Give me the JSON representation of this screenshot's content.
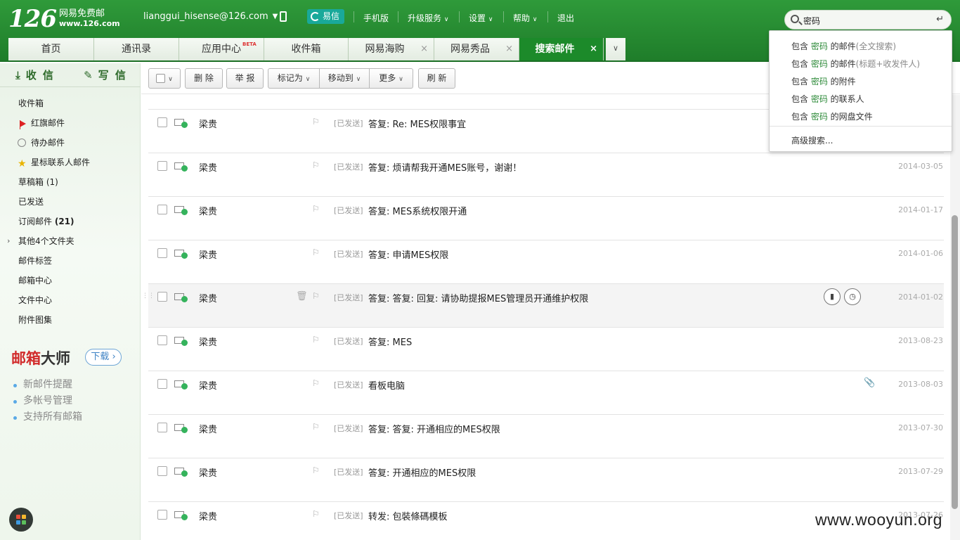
{
  "header": {
    "logo_num": "126",
    "logo_cn": "网易免费邮",
    "logo_url": "www.126.com",
    "account": "lianggui_hisense@126.com",
    "yixin_label": "易信",
    "nav": [
      "手机版",
      "升级服务",
      "设置",
      "帮助",
      "退出"
    ]
  },
  "search": {
    "query": "密码",
    "enter_symbol": "↵"
  },
  "tabs": [
    {
      "label": "首页"
    },
    {
      "label": "通讯录"
    },
    {
      "label": "应用中心",
      "badge": "BETA"
    },
    {
      "label": "收件箱"
    },
    {
      "label": "网易海购"
    },
    {
      "label": "网易秀品"
    },
    {
      "label": "搜索邮件",
      "active": true
    }
  ],
  "sidebar": {
    "receive_label": "收 信",
    "write_label": "写 信",
    "items": [
      {
        "label": "收件箱"
      },
      {
        "label": "红旗邮件",
        "icon": "red-flag-icon"
      },
      {
        "label": "待办邮件",
        "icon": "clock-icon"
      },
      {
        "label": "星标联系人邮件",
        "icon": "star-icon"
      },
      {
        "label": "草稿箱",
        "count": "(1)"
      },
      {
        "label": "已发送"
      },
      {
        "label": "订阅邮件",
        "count": "(21)"
      },
      {
        "label": "其他4个文件夹",
        "expandable": true
      },
      {
        "label": "邮件标签"
      },
      {
        "label": "邮箱中心"
      },
      {
        "label": "文件中心"
      },
      {
        "label": "附件图集"
      }
    ],
    "promo": {
      "title_red": "邮箱",
      "title_rest": "大师",
      "download": "下载",
      "features": [
        "新邮件提醒",
        "多帐号管理",
        "支持所有邮箱"
      ]
    }
  },
  "toolbar": {
    "delete": "删 除",
    "report": "举 报",
    "mark_as": "标记为",
    "move_to": "移动到",
    "more": "更多",
    "refresh": "刷 新"
  },
  "mails": [
    {
      "sender": "梁贵",
      "tag": "[已发送]",
      "subject": "答复: Re: MES权限事宜",
      "date": ""
    },
    {
      "sender": "梁贵",
      "tag": "[已发送]",
      "subject": "答复: 烦请帮我开通MES账号，谢谢！",
      "date": "2014-03-05"
    },
    {
      "sender": "梁贵",
      "tag": "[已发送]",
      "subject": "答复: MES系统权限开通",
      "date": "2014-01-17"
    },
    {
      "sender": "梁贵",
      "tag": "[已发送]",
      "subject": "答复: 申请MES权限",
      "date": "2014-01-06"
    },
    {
      "sender": "梁贵",
      "tag": "[已发送]",
      "subject": "答复: 答复: 回复: 请协助提报MES管理员开通维护权限",
      "date": "2014-01-02",
      "hover": true
    },
    {
      "sender": "梁贵",
      "tag": "[已发送]",
      "subject": "答复: MES",
      "date": "2013-08-23"
    },
    {
      "sender": "梁贵",
      "tag": "[已发送]",
      "subject": "看板电脑",
      "date": "2013-08-03",
      "attachment": true
    },
    {
      "sender": "梁贵",
      "tag": "[已发送]",
      "subject": "答复: 答复: 开通相应的MES权限",
      "date": "2013-07-30"
    },
    {
      "sender": "梁贵",
      "tag": "[已发送]",
      "subject": "答复: 开通相应的MES权限",
      "date": "2013-07-29"
    },
    {
      "sender": "梁贵",
      "tag": "[已发送]",
      "subject": "转发: 包裝條碼模板",
      "date": "2013-07-26"
    }
  ],
  "dropdown": {
    "items": [
      {
        "prefix": "包含 ",
        "kw": "密码",
        "suffix": " 的邮件",
        "hint": "(全文搜索)"
      },
      {
        "prefix": "包含 ",
        "kw": "密码",
        "suffix": " 的邮件",
        "hint": "(标题+收发件人)"
      },
      {
        "prefix": "包含 ",
        "kw": "密码",
        "suffix": " 的附件",
        "hint": ""
      },
      {
        "prefix": "包含 ",
        "kw": "密码",
        "suffix": " 的联系人",
        "hint": ""
      },
      {
        "prefix": "包含 ",
        "kw": "密码",
        "suffix": " 的网盘文件",
        "hint": ""
      }
    ],
    "advanced": "高级搜索..."
  },
  "watermark": "www.wooyun.org",
  "colors": {
    "brand_green": "#1f7d2a",
    "keyword_green": "#2e8b3a",
    "promo_red": "#d12a2a",
    "yixin_teal": "#19a99a"
  }
}
